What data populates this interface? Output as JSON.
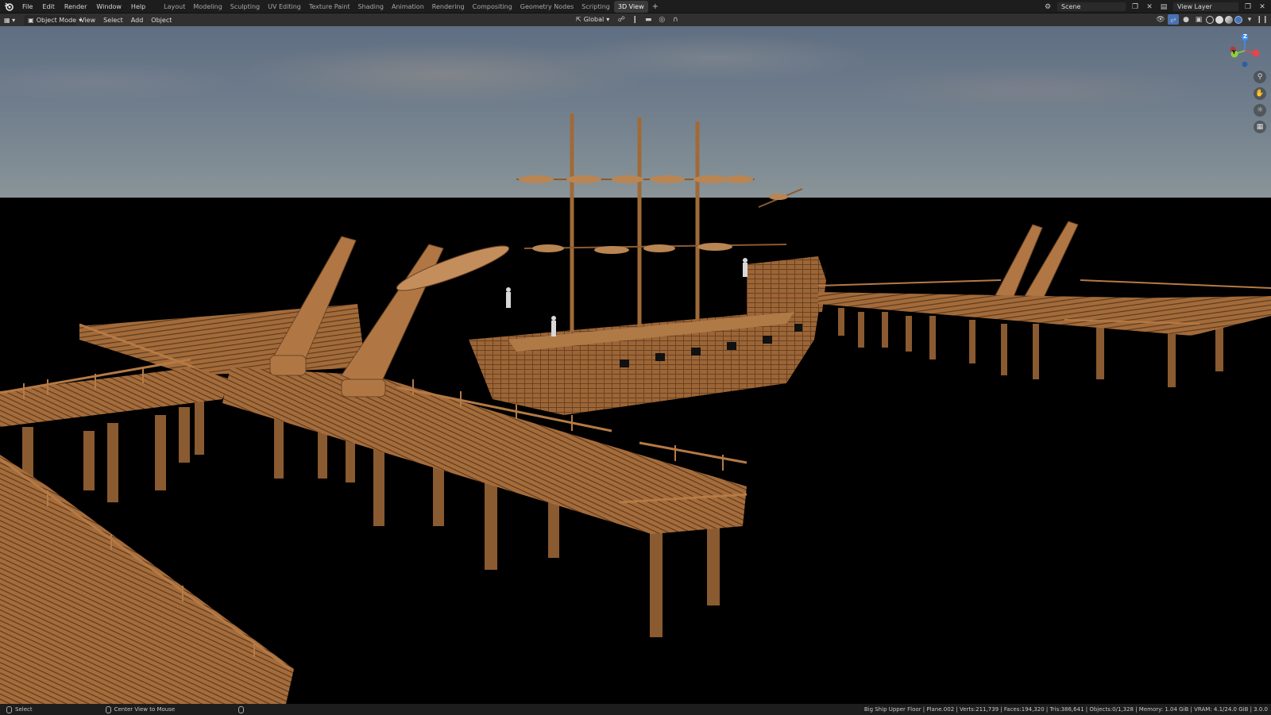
{
  "menu": {
    "items": [
      "File",
      "Edit",
      "Render",
      "Window",
      "Help"
    ]
  },
  "workspaces": {
    "tabs": [
      "Layout",
      "Modeling",
      "Sculpting",
      "UV Editing",
      "Texture Paint",
      "Shading",
      "Animation",
      "Rendering",
      "Compositing",
      "Geometry Nodes",
      "Scripting",
      "3D View"
    ],
    "active": "3D View",
    "add_label": "+"
  },
  "scene": {
    "name": "Scene"
  },
  "view_layer": {
    "name": "View Layer"
  },
  "header": {
    "mode": "Object Mode",
    "menus": [
      "View",
      "Select",
      "Add",
      "Object"
    ],
    "orientation": "Global"
  },
  "gizmo": {
    "axis_z": "Z",
    "axis_y": "Y",
    "colors": {
      "x": "#e8454a",
      "y": "#8fd13b",
      "z": "#3f8ef0"
    }
  },
  "status": {
    "left_action": "Select",
    "middle_action": "Center View to Mouse",
    "stats": "Big Ship Upper Floor | Plane.002 | Verts:211,739 | Faces:194,320 | Tris:386,641 | Objects:0/1,328 | Memory: 1.04 GiB | VRAM: 4.1/24.0 GiB | 3.0.0"
  },
  "colors": {
    "wood": "#a86f3e",
    "ui_dark": "#1d1d1d",
    "ui_header": "#303030",
    "accent": "#4772b3"
  }
}
